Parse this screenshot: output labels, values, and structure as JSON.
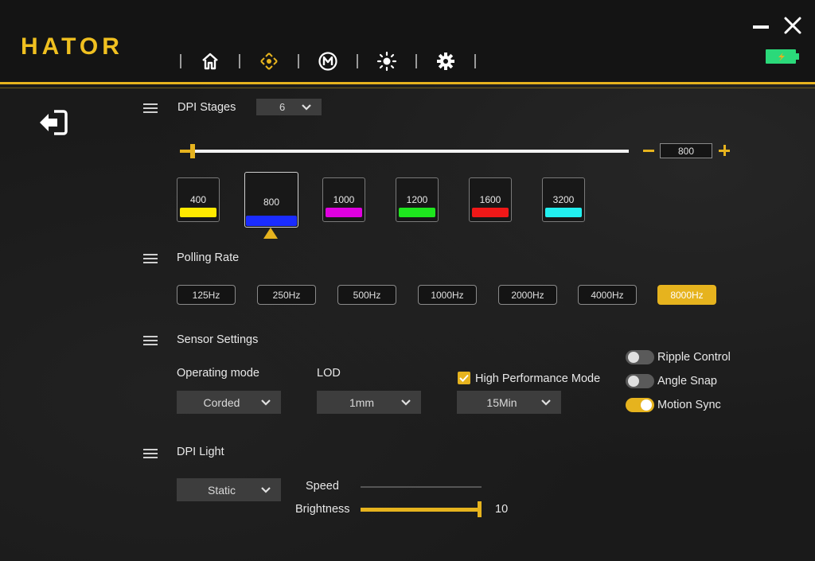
{
  "app": {
    "logo": "HATOR",
    "nav": [
      {
        "icon": "home-icon",
        "active": false
      },
      {
        "icon": "dpi-crosshair-icon",
        "active": true
      },
      {
        "icon": "macro-m-icon",
        "active": false
      },
      {
        "icon": "brightness-sun-icon",
        "active": false
      },
      {
        "icon": "gear-icon",
        "active": false
      }
    ],
    "accent_color": "#e6b31e",
    "battery_color": "#2bd97a"
  },
  "dpi_stages": {
    "title": "DPI Stages",
    "count_selected": "6",
    "current_dpi": "800",
    "slider_fraction": 0.014,
    "stages": [
      {
        "value": "400",
        "color": "#ffea00"
      },
      {
        "value": "800",
        "color": "#1a2cff",
        "selected": true
      },
      {
        "value": "1000",
        "color": "#e000e0"
      },
      {
        "value": "1200",
        "color": "#1ee61e"
      },
      {
        "value": "1600",
        "color": "#f01818"
      },
      {
        "value": "3200",
        "color": "#22f0f0"
      }
    ]
  },
  "polling_rate": {
    "title": "Polling Rate",
    "rates": [
      "125Hz",
      "250Hz",
      "500Hz",
      "1000Hz",
      "2000Hz",
      "4000Hz",
      "8000Hz"
    ],
    "selected": "8000Hz"
  },
  "sensor_settings": {
    "title": "Sensor Settings",
    "operating_mode_label": "Operating mode",
    "operating_mode_value": "Corded",
    "lod_label": "LOD",
    "lod_value": "1mm",
    "high_performance_label": "High Performance Mode",
    "high_performance_checked": true,
    "high_performance_value": "15Min",
    "toggles": [
      {
        "label": "Ripple Control",
        "on": false
      },
      {
        "label": "Angle Snap",
        "on": false
      },
      {
        "label": "Motion Sync",
        "on": true
      }
    ]
  },
  "dpi_light": {
    "title": "DPI Light",
    "mode_value": "Static",
    "speed_label": "Speed",
    "speed_fraction": 0,
    "brightness_label": "Brightness",
    "brightness_value": "10",
    "brightness_fraction": 1.0
  }
}
